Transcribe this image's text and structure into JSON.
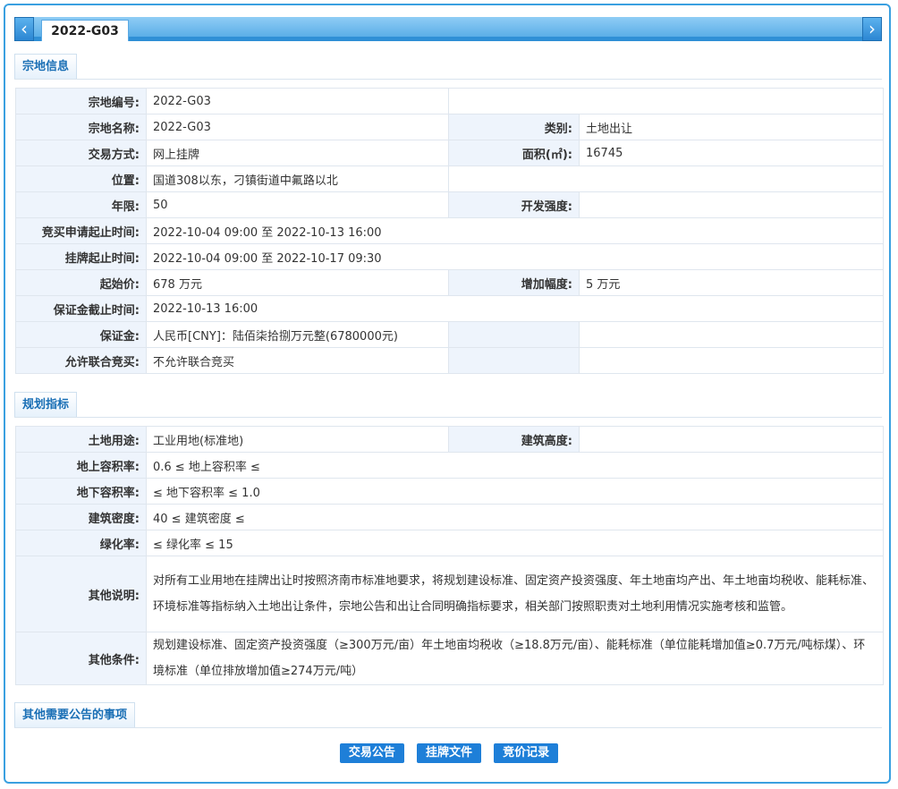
{
  "tab": {
    "prev_icon": "‹",
    "next_icon": "›",
    "title": "2022-G03"
  },
  "sections": {
    "info": "宗地信息",
    "planning": "规划指标",
    "other": "其他需要公告的事项"
  },
  "info": {
    "code_label": "宗地编号:",
    "code": "2022-G03",
    "name_label": "宗地名称:",
    "name": "2022-G03",
    "category_label": "类别:",
    "category": "土地出让",
    "method_label": "交易方式:",
    "method": "网上挂牌",
    "area_label": "面积(㎡):",
    "area": "16745",
    "location_label": "位置:",
    "location": "国道308以东，刁镇街道中氟路以北",
    "term_label": "年限:",
    "term": "50",
    "intensity_label": "开发强度:",
    "intensity": "",
    "apply_label": "竞买申请起止时间:",
    "apply": "2022-10-04 09:00 至 2022-10-13 16:00",
    "listing_label": "挂牌起止时间:",
    "listing": "2022-10-04 09:00 至 2022-10-17 09:30",
    "start_price_label": "起始价:",
    "start_price": "678 万元",
    "increment_label": "增加幅度:",
    "increment": "5 万元",
    "deposit_deadline_label": "保证金截止时间:",
    "deposit_deadline": "2022-10-13 16:00",
    "deposit_label": "保证金:",
    "deposit": "人民币[CNY]：陆佰柒拾捌万元整(6780000元)",
    "joint_label": "允许联合竞买:",
    "joint": "不允许联合竞买"
  },
  "planning": {
    "use_label": "土地用途:",
    "use": "工业用地(标准地)",
    "height_label": "建筑高度:",
    "height": "",
    "far_above_label": "地上容积率:",
    "far_above": "0.6 ≤ 地上容积率 ≤",
    "far_below_label": "地下容积率:",
    "far_below": "≤ 地下容积率 ≤ 1.0",
    "density_label": "建筑密度:",
    "density": "40 ≤ 建筑密度 ≤",
    "green_label": "绿化率:",
    "green": "≤ 绿化率 ≤ 15",
    "note_label": "其他说明:",
    "note": "对所有工业用地在挂牌出让时按照济南市标准地要求，将规划建设标准、固定资产投资强度、年土地亩均产出、年土地亩均税收、能耗标准、环境标准等指标纳入土地出让条件，宗地公告和出让合同明确指标要求，相关部门按照职责对土地利用情况实施考核和监管。",
    "cond_label": "其他条件:",
    "cond": "规划建设标准、固定资产投资强度（≥300万元/亩）年土地亩均税收（≥18.8万元/亩）、能耗标准（单位能耗增加值≥0.7万元/吨标煤）、环境标准（单位排放增加值≥274万元/吨）"
  },
  "buttons": {
    "announcement": "交易公告",
    "listing_docs": "挂牌文件",
    "bid_record": "竞价记录"
  }
}
